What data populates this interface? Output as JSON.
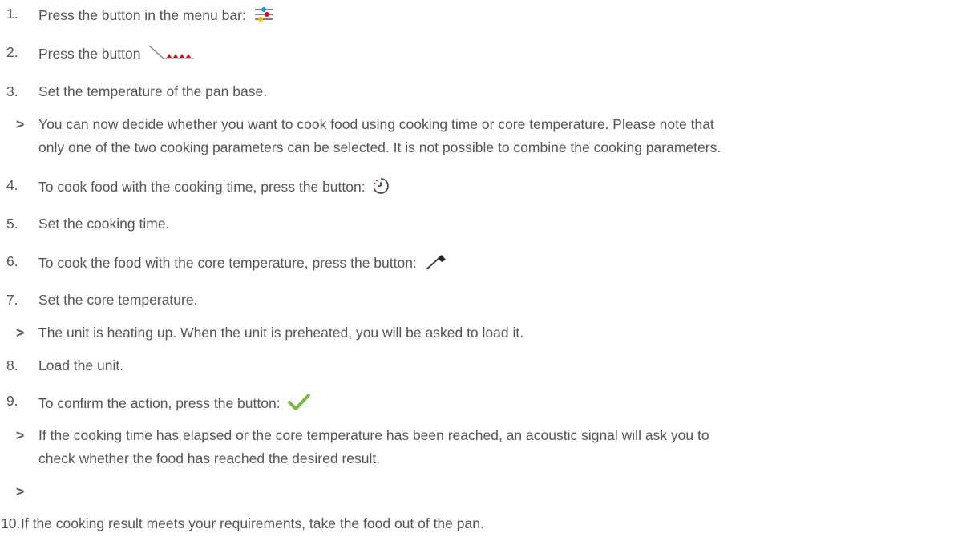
{
  "steps": [
    {
      "num": "1.",
      "text": "Press the button in the menu bar:",
      "icon": "settings-sliders-icon"
    },
    {
      "num": "2.",
      "text": "Press the button",
      "icon": "pan-heating-icon"
    },
    {
      "num": "3.",
      "text": "Set the temperature of the pan base."
    },
    {
      "num": ">",
      "line1": "You can now decide whether you want to cook food using cooking time or core temperature. Please note that",
      "line2": "only one of the two cooking parameters can be selected. It is not possible to combine the cooking parameters."
    },
    {
      "num": "4.",
      "text": "To cook food with the cooking time, press the button:",
      "icon": "timer-icon"
    },
    {
      "num": "5.",
      "text": "Set the cooking time."
    },
    {
      "num": "6.",
      "text": "To cook the food with the core temperature, press the button:",
      "icon": "core-probe-icon"
    },
    {
      "num": "7.",
      "text": "Set the core temperature."
    },
    {
      "num": ">",
      "text": "The unit is heating up. When the unit is preheated, you will be asked to load it."
    },
    {
      "num": "8.",
      "text": "Load the unit."
    },
    {
      "num": "9.",
      "text": "To confirm the action, press the button:",
      "icon": "checkmark-icon"
    },
    {
      "num": ">",
      "line1": "If the cooking time has elapsed or the core temperature has been reached, an acoustic signal will ask you to",
      "line2": "check whether the food has reached the desired result."
    },
    {
      "num": ">"
    },
    {
      "num": "10.",
      "text": "If the cooking result meets your requirements, take the food out of the pan."
    }
  ],
  "colors": {
    "text": "#555555",
    "blue": "#1a9ad6",
    "red": "#e2001a",
    "yellow": "#f5b800",
    "green": "#7ab648"
  }
}
